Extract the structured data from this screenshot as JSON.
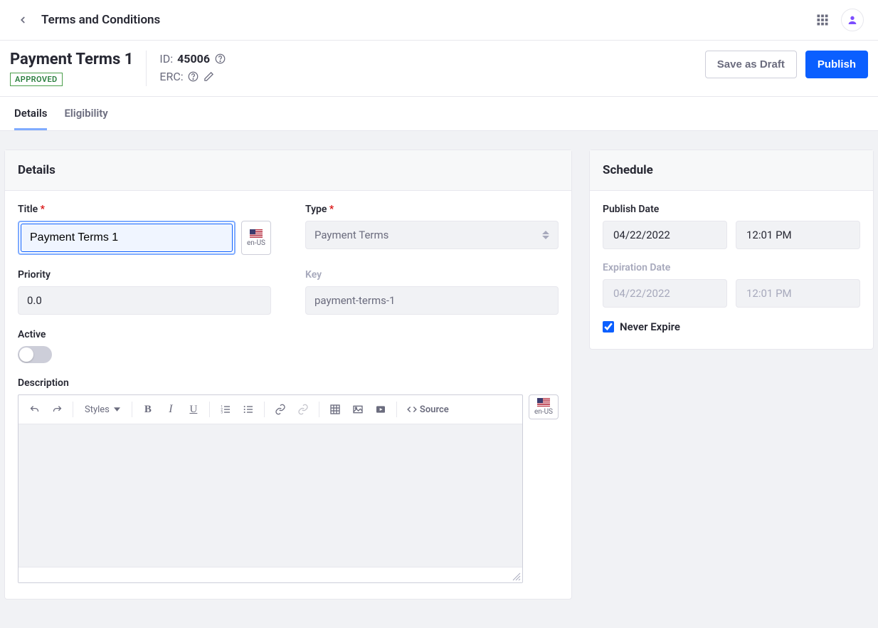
{
  "topbar": {
    "title": "Terms and Conditions"
  },
  "header": {
    "page_title": "Payment Terms 1",
    "badge": "APPROVED",
    "id_label": "ID:",
    "id_value": "45006",
    "erc_label": "ERC:",
    "save_draft": "Save as Draft",
    "publish": "Publish"
  },
  "tabs": {
    "details": "Details",
    "eligibility": "Eligibility"
  },
  "details": {
    "card_title": "Details",
    "title_label": "Title",
    "title_value": "Payment Terms 1",
    "locale": "en-US",
    "type_label": "Type",
    "type_value": "Payment Terms",
    "priority_label": "Priority",
    "priority_value": "0.0",
    "key_label": "Key",
    "key_value": "payment-terms-1",
    "active_label": "Active",
    "description_label": "Description",
    "styles_label": "Styles",
    "source_label": "Source"
  },
  "schedule": {
    "card_title": "Schedule",
    "publish_date_label": "Publish Date",
    "publish_date": "04/22/2022",
    "publish_time": "12:01 PM",
    "expiration_date_label": "Expiration Date",
    "expiration_date": "04/22/2022",
    "expiration_time": "12:01 PM",
    "never_expire_label": "Never Expire",
    "never_expire_checked": true
  }
}
